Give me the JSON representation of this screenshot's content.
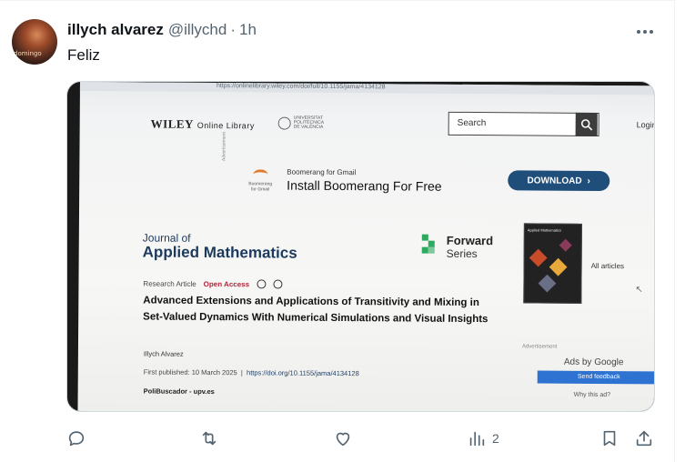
{
  "tweet": {
    "author_name": "illych alvarez",
    "handle": "@illychd",
    "separator": "·",
    "time": "1h",
    "text": "Feliz",
    "avatar_caption": "domingo",
    "views_count": "2"
  },
  "screenshot": {
    "url": "https://onlinelibrary.wiley.com/doi/full/10.1155/jama/4134128",
    "wiley_brand": "WILEY",
    "wiley_sub": "Online Library",
    "upv_line1": "UNIVERSITAT",
    "upv_line2": "POLITÈCNICA",
    "upv_line3": "DE VALÈNCIA",
    "search_label": "Search",
    "login": "Login",
    "advertisement_vertical": "Advertisement",
    "boomerang_logo": "Boomerang for Gmail",
    "boomerang_small": "Boomerang for Gmail",
    "boomerang_big": "Install Boomerang For Free",
    "download_label": "DOWNLOAD",
    "journal_of": "Journal of",
    "journal_title": "Applied Mathematics",
    "forward": "Forward",
    "series": "Series",
    "cover_header": "Applied Mathematics",
    "all_articles": "All articles",
    "article_type": "Research Article",
    "open_access": "Open Access",
    "article_title": "Advanced Extensions and Applications of Transitivity and Mixing in Set-Valued Dynamics With Numerical Simulations and Visual Insights",
    "author": "Illych Alvarez",
    "first_published": "First published: 10 March 2025",
    "doi": "https://doi.org/10.1155/jama/4134128",
    "polibuscador": "PoliBuscador - upv.es",
    "advertisement_right": "Advertisement",
    "ads_by_google": "Ads by Google",
    "send_feedback": "Send feedback",
    "why_ad": "Why this ad?"
  },
  "icons": {
    "reply": "reply-icon",
    "retweet": "retweet-icon",
    "like": "heart-icon",
    "views": "views-icon",
    "bookmark": "bookmark-icon",
    "share": "share-icon",
    "more": "more-icon"
  },
  "colors": {
    "text_primary": "#0f1419",
    "text_secondary": "#536471",
    "journal_blue": "#1c3a5e",
    "download_btn": "#1f4e7a",
    "forward_green": "#2eaa60"
  }
}
